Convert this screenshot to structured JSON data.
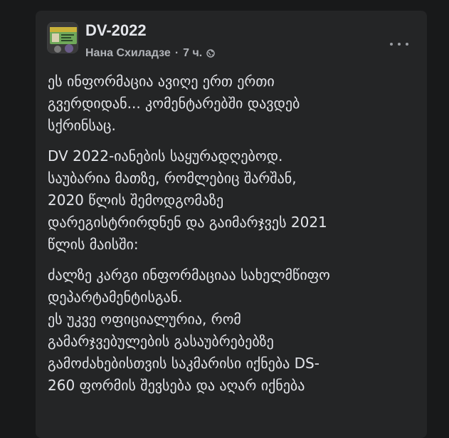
{
  "post": {
    "group_name": "DV-2022",
    "author": "Нана Схиладзе",
    "separator": "·",
    "time": "7 ч.",
    "privacy_icon": "globe-icon",
    "menu_icon": "more-horizontal-icon",
    "avatar_icon": "green-card-icon",
    "paragraphs": [
      "ეს ინფორმაცია ავიღე ერთ ერთი\nგვერდიდან... კომენტარებში დავდებ\nსქრინსაც.",
      "DV 2022-იანების საყურადღებოდ.\nსაუბარია მათზე, რომლებიც შარშან,\n2020 წლის შემოდგომაზე\nდარეგისტრირდნენ და გაიმარჯვეს 2021\nწლის მაისში:",
      "ძალზე კარგი ინფორმაციაა სახელმწიფო\nდეპარტამენტისგან.\nეს უკვე ოფიციალურია, რომ\nგამარჯვებულების გასაუბრებებზე\nგამოძახებისთვის საკმარისი იქნება DS-\n260 ფორმის შევსება და აღარ იქნება"
    ]
  },
  "colors": {
    "page_bg": "#18191a",
    "card_bg": "#242526",
    "primary_text": "#e4e6eb",
    "secondary_text": "#b0b3b8"
  }
}
